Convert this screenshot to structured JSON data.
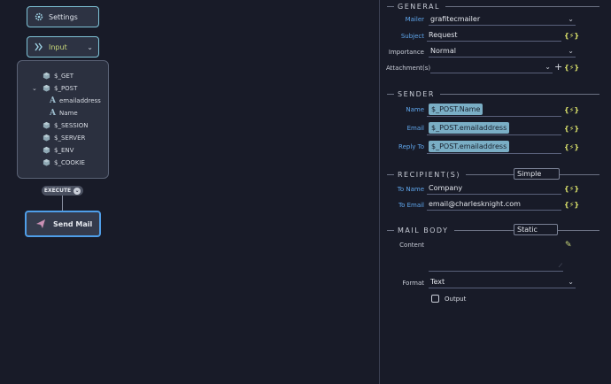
{
  "canvas": {
    "settings_node": {
      "label": "Settings"
    },
    "input_node": {
      "label": "Input"
    },
    "variables": [
      {
        "label": "$_GET"
      },
      {
        "label": "$_POST"
      },
      {
        "label": "emailaddress"
      },
      {
        "label": "Name"
      },
      {
        "label": "$_SESSION"
      },
      {
        "label": "$_SERVER"
      },
      {
        "label": "$_ENV"
      },
      {
        "label": "$_COOKIE"
      }
    ],
    "execute": {
      "label": "EXECUTE"
    },
    "sendmail_node": {
      "label": "Send Mail"
    }
  },
  "props": {
    "general": {
      "title": "GENERAL",
      "mailer": {
        "label": "Mailer",
        "value": "grafitecmailer"
      },
      "subject": {
        "label": "Subject",
        "value": "Request"
      },
      "importance": {
        "label": "Importance",
        "value": "Normal"
      },
      "attachments": {
        "label": "Attachment(s)",
        "value": ""
      }
    },
    "sender": {
      "title": "SENDER",
      "name": {
        "label": "Name",
        "value": "$_POST.Name"
      },
      "email": {
        "label": "Email",
        "value": "$_POST.emailaddress"
      },
      "reply_to": {
        "label": "Reply To",
        "value": "$_POST.emailaddress"
      }
    },
    "recipients": {
      "title": "RECIPIENT(S)",
      "mode": "Simple",
      "to_name": {
        "label": "To Name",
        "value": "Company"
      },
      "to_email": {
        "label": "To Email",
        "value": "email@charlesknight.com"
      }
    },
    "mail_body": {
      "title": "MAIL BODY",
      "mode": "Static",
      "content": {
        "label": "Content",
        "value": ""
      },
      "format": {
        "label": "Format",
        "value": "Text"
      },
      "output": {
        "label": "Output"
      }
    },
    "dynamic_symbol": "{⚡}",
    "colors": {
      "accent": "#5fa6ec",
      "node_border": "#7fc4d8",
      "selected_border": "#4f9ee8",
      "bolt": "#d9e06a"
    }
  }
}
